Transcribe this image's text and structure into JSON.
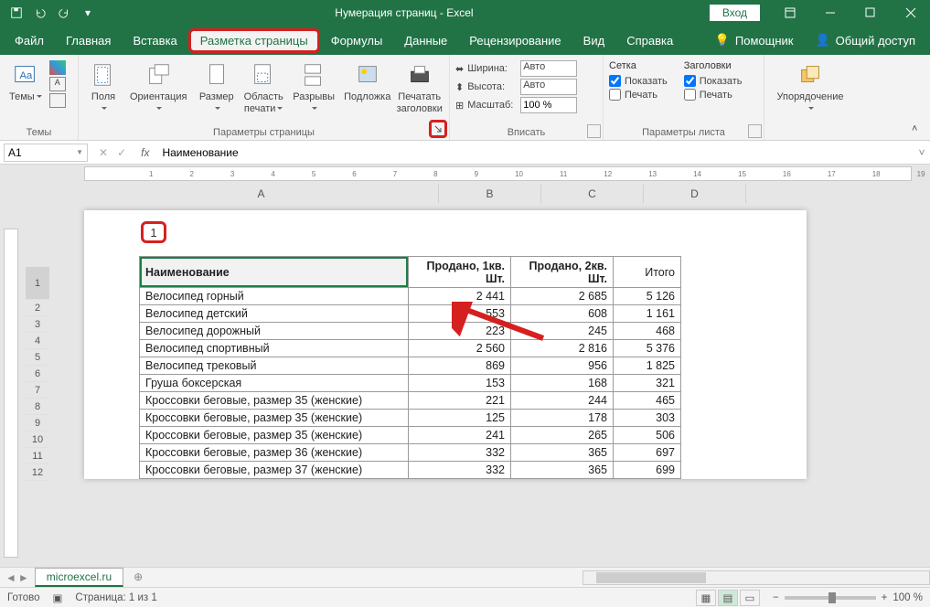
{
  "title": "Нумерация страниц  -  Excel",
  "signin": "Вход",
  "tabs": {
    "file": "Файл",
    "home": "Главная",
    "insert": "Вставка",
    "pagelayout": "Разметка страницы",
    "formulas": "Формулы",
    "data": "Данные",
    "review": "Рецензирование",
    "view": "Вид",
    "help": "Справка",
    "tellme": "Помощник",
    "share": "Общий доступ"
  },
  "ribbon": {
    "themes": {
      "label": "Темы",
      "btn": "Темы"
    },
    "pagesetup": {
      "label": "Параметры страницы",
      "margins": "Поля",
      "orientation": "Ориентация",
      "size": "Размер",
      "printarea": "Область\nпечати",
      "breaks": "Разрывы",
      "background": "Подложка",
      "printtitles": "Печатать\nзаголовки"
    },
    "scaletofit": {
      "label": "Вписать",
      "width": "Ширина:",
      "height": "Высота:",
      "scale": "Масштаб:",
      "auto": "Авто",
      "scaleval": "100 %"
    },
    "sheetoptions": {
      "label": "Параметры листа",
      "gridlines": "Сетка",
      "headings": "Заголовки",
      "view": "Показать",
      "print": "Печать"
    },
    "arrange": {
      "label": " ",
      "btn": "Упорядочение"
    }
  },
  "namebox": "A1",
  "formula": "Наименование",
  "page_number": "1",
  "columns": [
    "A",
    "B",
    "C",
    "D"
  ],
  "table": {
    "headers": [
      "Наименование",
      "Продано, 1кв. Шт.",
      "Продано, 2кв. Шт.",
      "Итого"
    ],
    "rows": [
      [
        "Велосипед горный",
        "2 441",
        "2 685",
        "5 126"
      ],
      [
        "Велосипед детский",
        "553",
        "608",
        "1 161"
      ],
      [
        "Велосипед дорожный",
        "223",
        "245",
        "468"
      ],
      [
        "Велосипед спортивный",
        "2 560",
        "2 816",
        "5 376"
      ],
      [
        "Велосипед трековый",
        "869",
        "956",
        "1 825"
      ],
      [
        "Груша боксерская",
        "153",
        "168",
        "321"
      ],
      [
        "Кроссовки беговые, размер 35 (женские)",
        "221",
        "244",
        "465"
      ],
      [
        "Кроссовки беговые, размер 35 (женские)",
        "125",
        "178",
        "303"
      ],
      [
        "Кроссовки беговые, размер 35 (женские)",
        "241",
        "265",
        "506"
      ],
      [
        "Кроссовки беговые, размер 36 (женские)",
        "332",
        "365",
        "697"
      ],
      [
        "Кроссовки беговые, размер 37 (женские)",
        "332",
        "365",
        "699"
      ]
    ]
  },
  "row_numbers": [
    "1",
    "2",
    "3",
    "4",
    "5",
    "6",
    "7",
    "8",
    "9",
    "10",
    "11",
    "12"
  ],
  "sheet_tab": "microexcel.ru",
  "status": {
    "ready": "Готово",
    "page": "Страница: 1 из 1",
    "zoom": "100 %"
  },
  "ruler_ticks": [
    "1",
    "2",
    "3",
    "4",
    "5",
    "6",
    "7",
    "8",
    "9",
    "10",
    "11",
    "12",
    "13",
    "14",
    "15",
    "16",
    "17",
    "18",
    "19"
  ]
}
